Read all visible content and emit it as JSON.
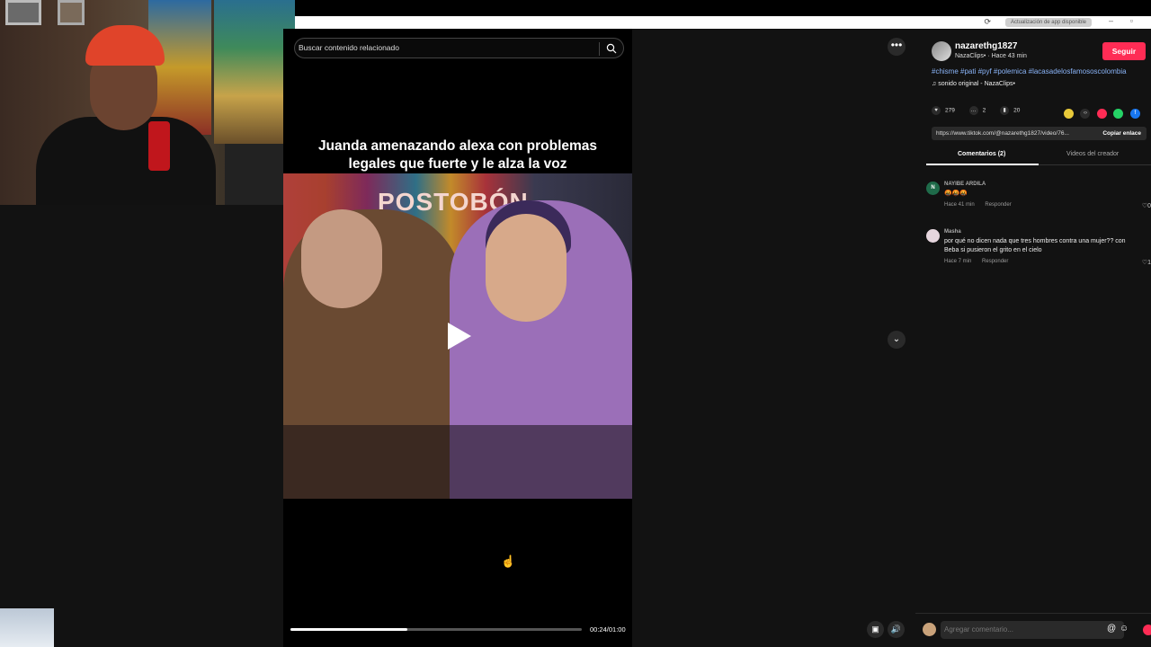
{
  "window": {
    "update_badge": "Actualización de app disponible",
    "menu_icon": "kebab-icon"
  },
  "search": {
    "placeholder": "Buscar contenido relacionado",
    "icon": "search-icon"
  },
  "video": {
    "caption_line1": "Juanda amenazando alexa con problemas",
    "caption_line2": "legales que fuerte  y le alza la voz",
    "brand_text": "POSTOBÓN",
    "progress": 0.4,
    "time": "00:24/01:00"
  },
  "creator": {
    "username": "nazarethg1827",
    "subline": "NazaClips• · Hace 43 min",
    "follow_label": "Seguir",
    "hashtags": "#chisme #pati #pyf #polemica #lacasadelosfamososcolombia",
    "sound": "sonido original - NazaClips•"
  },
  "stats": {
    "likes": "279",
    "comments": "2",
    "saves": "20"
  },
  "share": {
    "url": "https://www.tiktok.com/@nazarethg1827/video/76...",
    "copy_label": "Copiar enlace"
  },
  "tabs": {
    "comments": "Comentarios (2)",
    "creator_videos": "Videos del creador"
  },
  "comments": [
    {
      "avatar_letter": "N",
      "name": "NAYIBE ARDILA",
      "text": "🤬🤬🤬",
      "time": "Hace 41 min",
      "reply": "Responder",
      "likes": "0"
    },
    {
      "avatar_letter": "",
      "name": "Masha",
      "text": "por qué no dicen nada que tres hombres contra una mujer?? con Beba si pusieron el grito en el cielo",
      "time": "Hace 7 min",
      "reply": "Responder",
      "likes": "1"
    }
  ],
  "add_comment": {
    "placeholder": "Agregar comentario...",
    "at": "@",
    "emoji": "☺"
  },
  "colors": {
    "accent": "#fe2c55",
    "hashtag": "#8ab4f8",
    "background": "#121212"
  }
}
